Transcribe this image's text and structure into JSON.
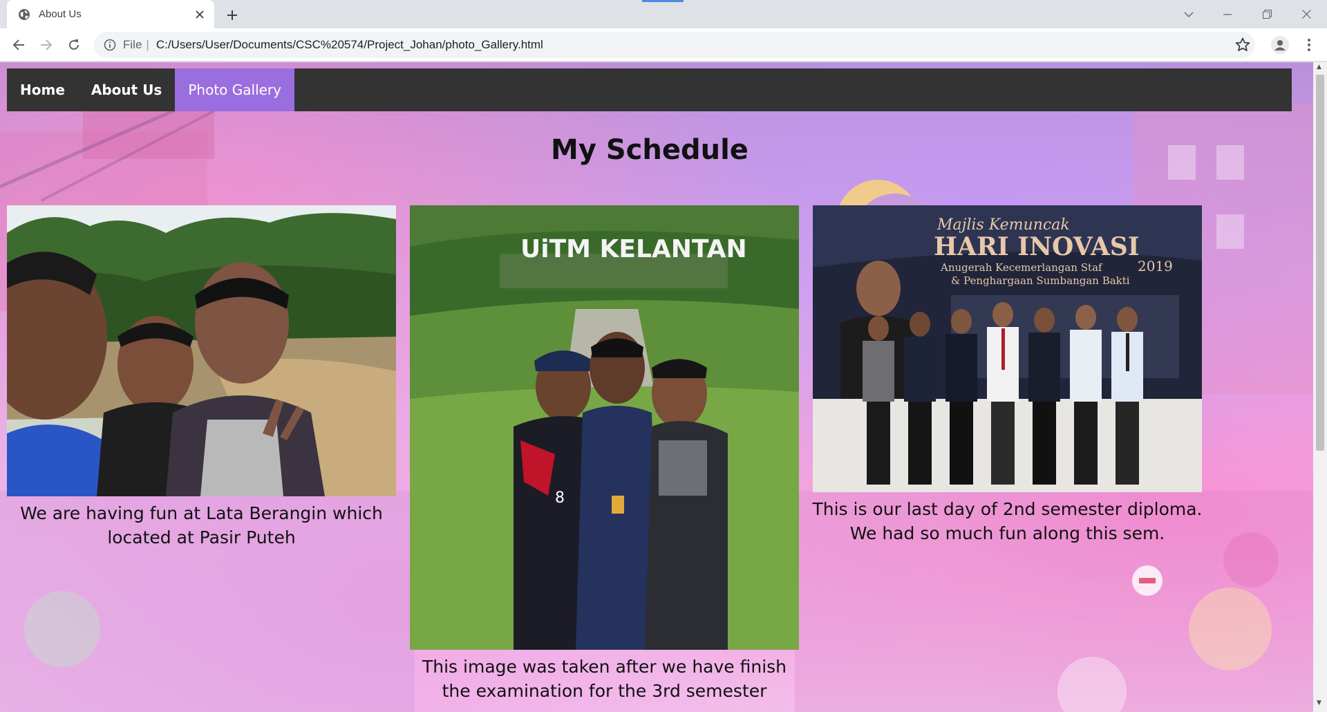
{
  "browser": {
    "tab_title": "About Us",
    "scheme": "File",
    "separator": "|",
    "url": "C:/Users/User/Documents/CSC%20574/Project_Johan/photo_Gallery.html",
    "icons": [
      "globe-icon",
      "close-icon",
      "plus-icon",
      "chevron-down-icon",
      "minimize-icon",
      "restore-icon",
      "close-window-icon",
      "back-arrow-icon",
      "forward-arrow-icon",
      "reload-icon",
      "info-icon",
      "star-icon",
      "profile-icon",
      "kebab-menu-icon"
    ]
  },
  "nav": {
    "items": [
      {
        "label": "Home",
        "active": false
      },
      {
        "label": "About Us",
        "active": false
      },
      {
        "label": "Photo Gallery",
        "active": true
      }
    ],
    "active_color": "#9b6ee0",
    "bar_color": "#333333"
  },
  "page": {
    "title": "My Schedule"
  },
  "gallery": [
    {
      "image_desc": "selfie of three friends at a river with rocks and forest",
      "caption_line1": "We are having fun at Lata Berangin which",
      "caption_line2": "located at Pasir Puteh"
    },
    {
      "image_desc": "three students posing under campus sign",
      "sign_text": "UiTM KELANTAN",
      "caption_line1": "This image was taken after we have finish",
      "caption_line2": "the examination for the 3rd semester"
    },
    {
      "image_desc": "group of seven in formal wear in front of event banner",
      "banner_script": "Majlis Kemuncak",
      "banner_title": "HARI INOVASI",
      "banner_year": "2019",
      "banner_sub1": "Anugerah Kecemerlangan Staf",
      "banner_sub2": "& Penghargaan Sumbangan Bakti",
      "caption_line1": "This is our last day of 2nd semester diploma.",
      "caption_line2": "We had so much fun along this sem."
    }
  ]
}
